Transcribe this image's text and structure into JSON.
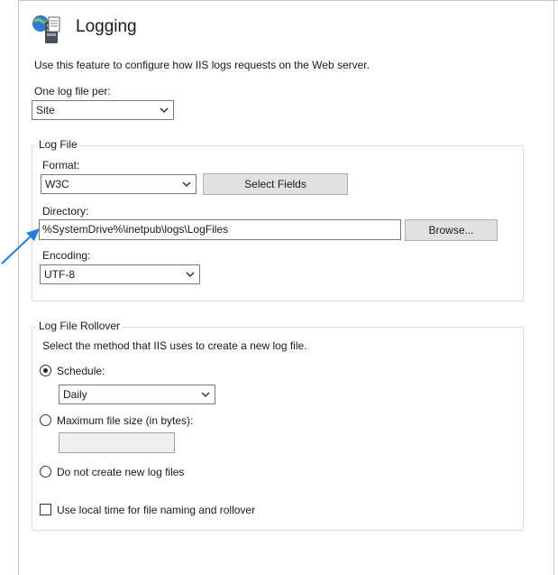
{
  "header": {
    "title": "Logging",
    "icon": "server-log-icon",
    "description": "Use this feature to configure how IIS logs requests on the Web server."
  },
  "log_file_per": {
    "label": "One log file per:",
    "value": "Site"
  },
  "log_file": {
    "group_title": "Log File",
    "format_label": "Format:",
    "format_value": "W3C",
    "select_fields_label": "Select Fields",
    "directory_label": "Directory:",
    "directory_value": "%SystemDrive%\\inetpub\\logs\\LogFiles",
    "browse_label": "Browse...",
    "encoding_label": "Encoding:",
    "encoding_value": "UTF-8"
  },
  "rollover": {
    "group_title": "Log File Rollover",
    "instructions": "Select the method that IIS uses to create a new log file.",
    "schedule_label": "Schedule:",
    "schedule_selected": true,
    "schedule_value": "Daily",
    "max_size_label": "Maximum file size (in bytes):",
    "max_size_value": "",
    "no_new_label": "Do not create new log files",
    "local_time_label": "Use local time for file naming and rollover",
    "local_time_checked": false
  },
  "annotation": {
    "arrow_color": "#1f7fe0"
  }
}
